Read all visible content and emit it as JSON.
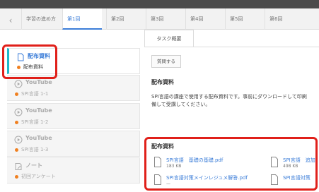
{
  "tabs": [
    {
      "label": "学習の進め方",
      "active": false
    },
    {
      "label": "第1回",
      "active": true
    },
    {
      "label": "第2回",
      "active": false
    },
    {
      "label": "第3回",
      "active": false
    },
    {
      "label": "第4回",
      "active": false
    },
    {
      "label": "第5回",
      "active": false
    },
    {
      "label": "第6回",
      "active": false
    }
  ],
  "sidebar": {
    "items": [
      {
        "title": "配布資料",
        "sub": "配布資料",
        "icon": "document-icon",
        "active": true
      },
      {
        "title": "YouTube",
        "sub": "SPI言語 1-1",
        "icon": "play-circle-icon",
        "active": false
      },
      {
        "title": "YouTube",
        "sub": "SPI言語 1-2",
        "icon": "play-circle-icon",
        "active": false
      },
      {
        "title": "YouTube",
        "sub": "SPI言語 1-3",
        "icon": "play-circle-icon",
        "active": false
      },
      {
        "title": "ノート",
        "sub": "初回アンケート",
        "icon": "note-icon",
        "active": false
      }
    ]
  },
  "main": {
    "subtab_label": "タスク概要",
    "question_button": "質問する",
    "section_title": "配布資料",
    "description_line1": "SPI言語の講座で使用する配布資料です。事前にダウンロードして印刷",
    "description_line2": "備して受講してください。",
    "files_title": "配布資料",
    "files": [
      {
        "name": "SPI言語　基礎の基礎.pdf",
        "size": "183 KB"
      },
      {
        "name": "SPI言語　追加",
        "size": "498 KB"
      },
      {
        "name": "SPI言語対策メインレジュメ解答.pdf",
        "size": "—"
      },
      {
        "name": "SPI言語対策",
        "size": ""
      }
    ]
  },
  "colors": {
    "accent": "#3b7dd8",
    "active_bar": "#20b7c9",
    "highlight": "#e0201a",
    "dot": "#f08020"
  }
}
